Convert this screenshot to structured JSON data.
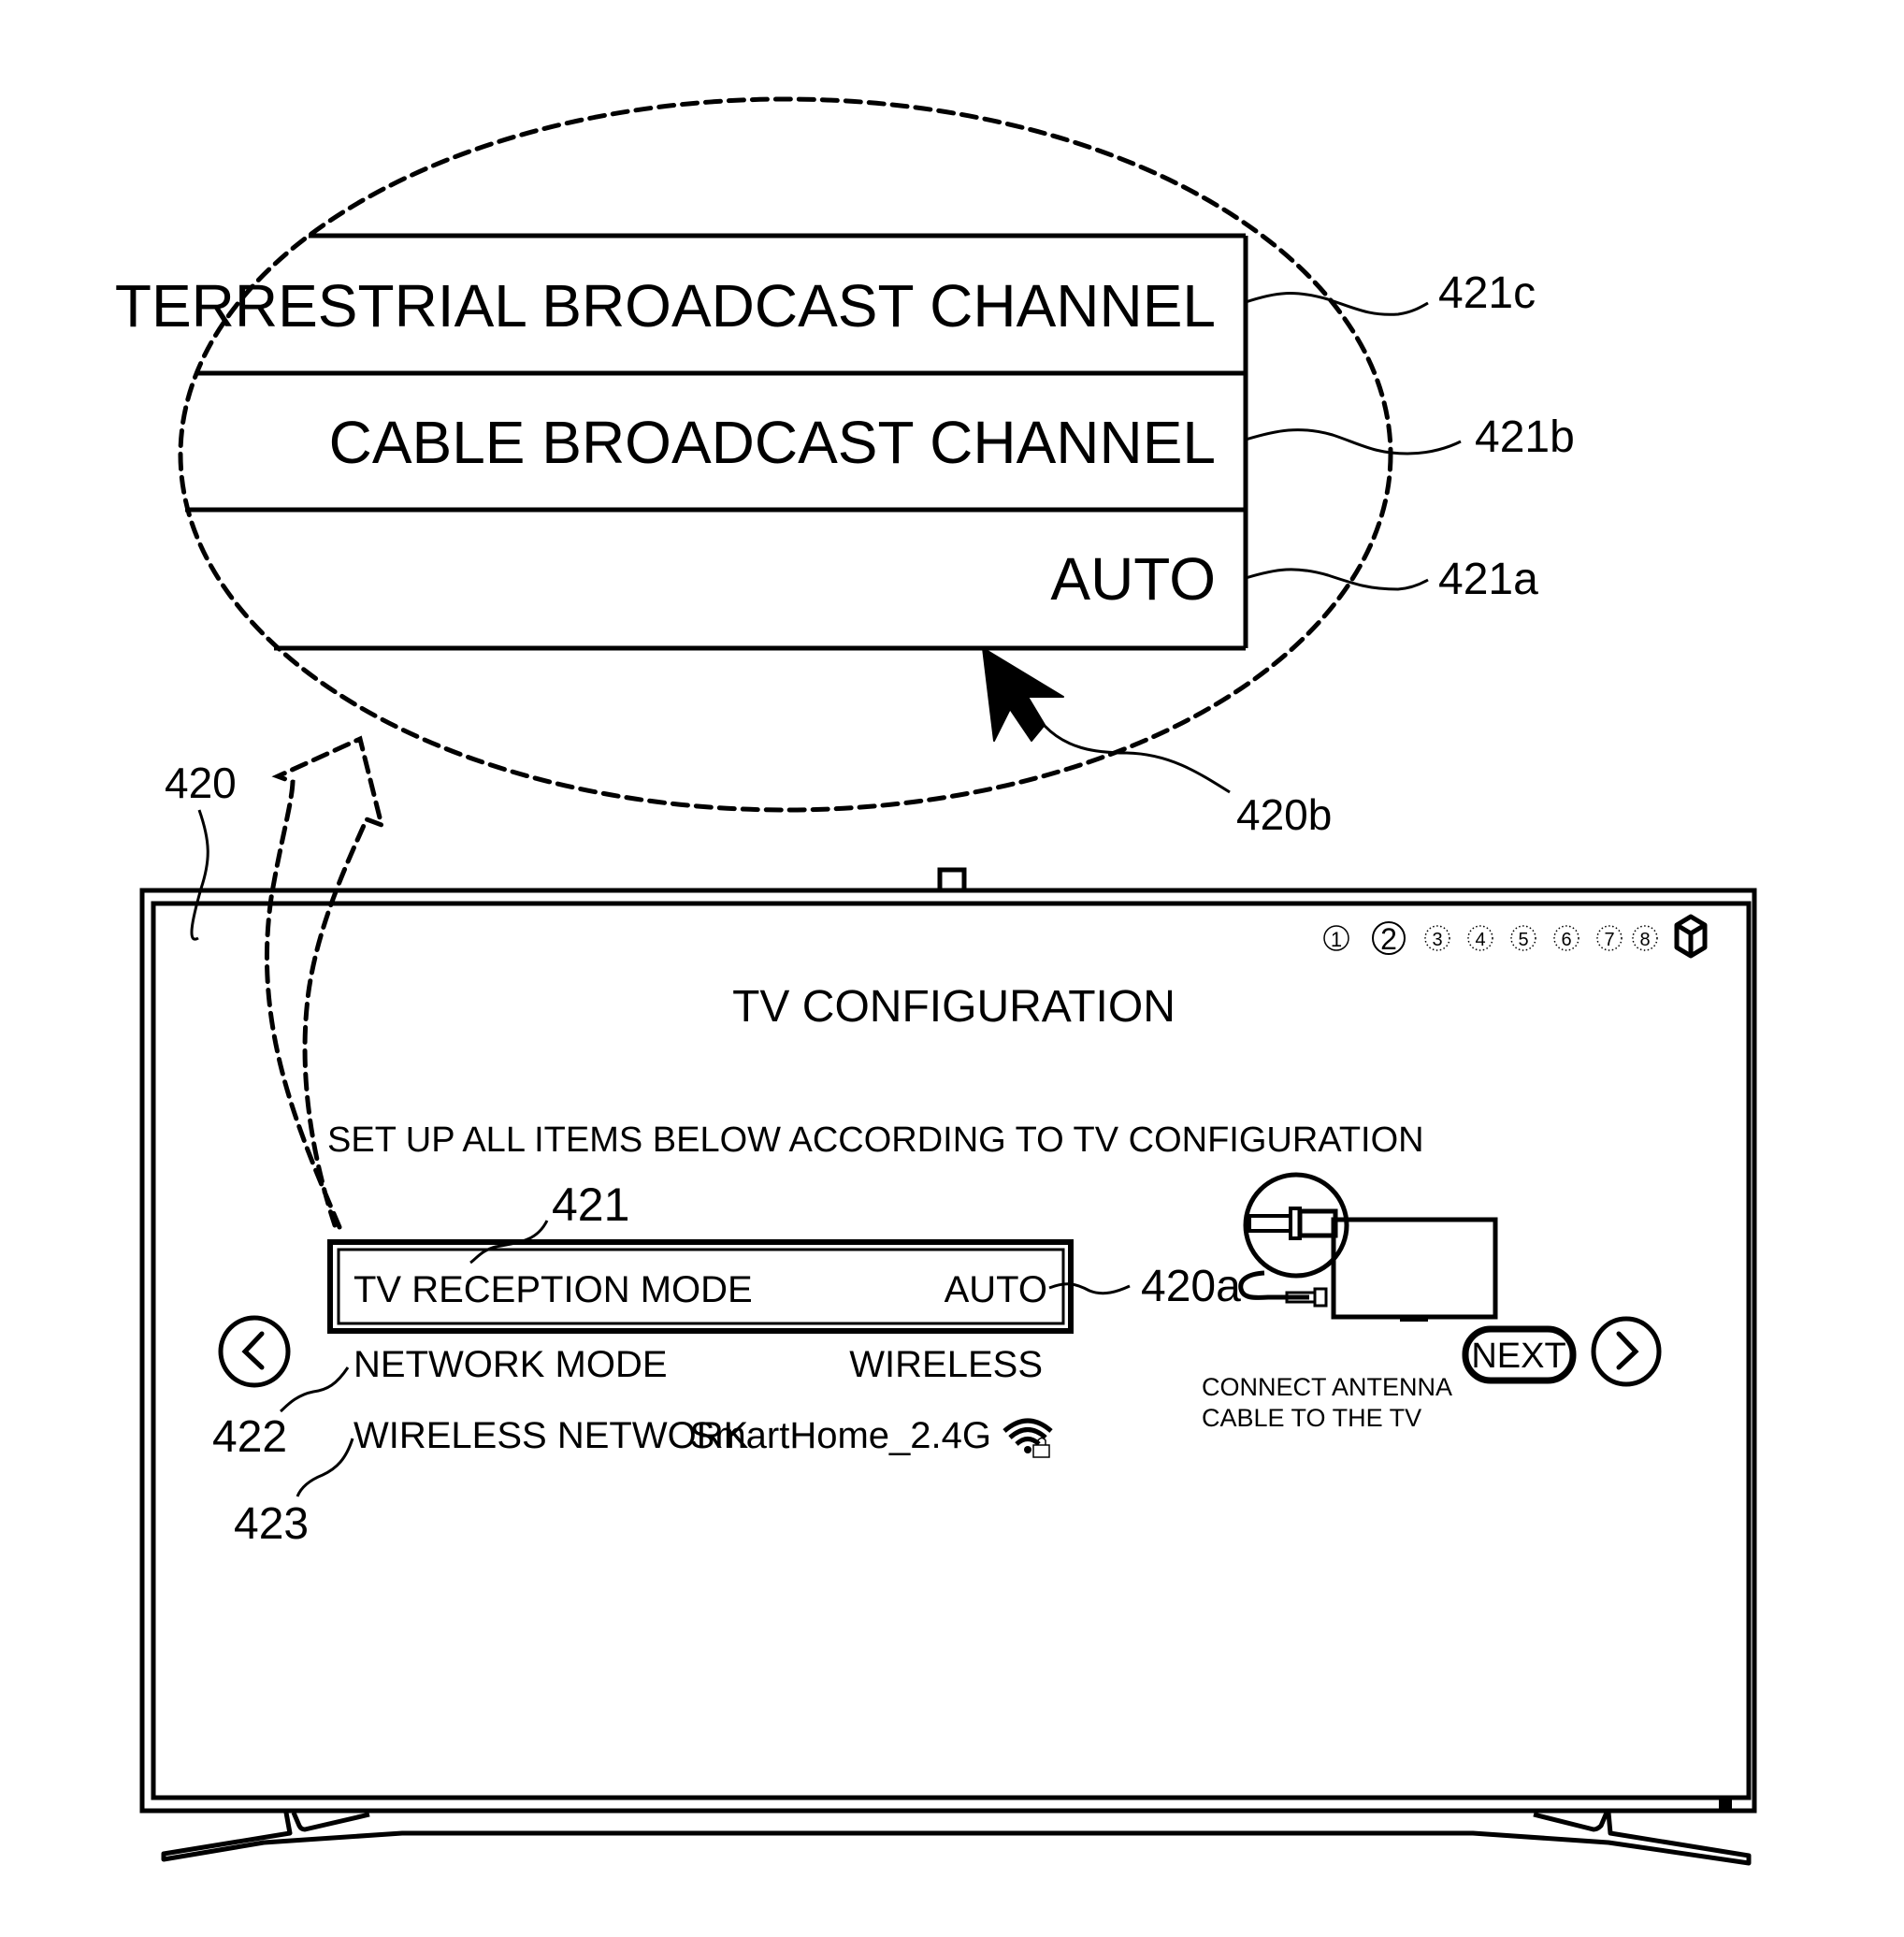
{
  "zoom_panel": {
    "options": [
      {
        "label": "TERRESTRIAL BROADCAST CHANNEL",
        "ref": "421c"
      },
      {
        "label": "CABLE BROADCAST CHANNEL",
        "ref": "421b"
      },
      {
        "label": "AUTO",
        "ref": "421a"
      }
    ],
    "cursor_ref": "420b"
  },
  "tv": {
    "ref": "420",
    "steps": {
      "labels": [
        "1",
        "2",
        "3",
        "4",
        "5",
        "6",
        "7",
        "8"
      ],
      "current": 2,
      "final_icon": "cube-icon"
    },
    "title": "TV CONFIGURATION",
    "instruction": "SET UP ALL ITEMS BELOW ACCORDING TO TV CONFIGURATION",
    "settings": [
      {
        "label": "TV RECEPTION MODE",
        "value": "AUTO",
        "ref": "421",
        "value_ref": "420a",
        "selected": true
      },
      {
        "label": "NETWORK MODE",
        "value": "WIRELESS",
        "ref": "422"
      },
      {
        "label": "WIRELESS NETWORK",
        "value": "SmartHome_2.4G",
        "ref": "423",
        "value_icon": "wifi-locked-icon"
      }
    ],
    "hint": {
      "line1": "CONNECT ANTENNA",
      "line2": "CABLE TO THE TV"
    },
    "nav": {
      "prev_icon": "chevron-left-icon",
      "next_label": "NEXT",
      "next_icon": "chevron-right-icon"
    }
  }
}
